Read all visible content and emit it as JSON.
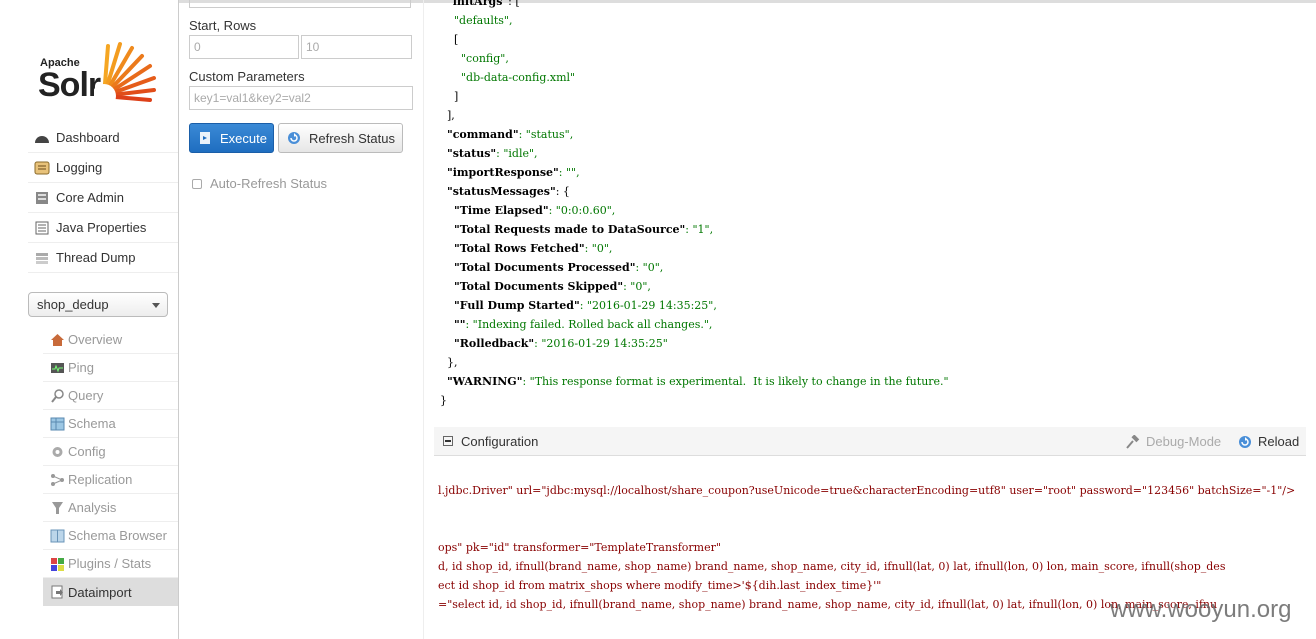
{
  "logo": {
    "apache": "Apache",
    "solr": "Solr"
  },
  "nav": {
    "items": [
      {
        "label": "Dashboard",
        "icon": "dashboard-icon"
      },
      {
        "label": "Logging",
        "icon": "logging-icon"
      },
      {
        "label": "Core Admin",
        "icon": "core-admin-icon"
      },
      {
        "label": "Java Properties",
        "icon": "java-properties-icon"
      },
      {
        "label": "Thread Dump",
        "icon": "thread-dump-icon"
      }
    ]
  },
  "core_selector": {
    "value": "shop_dedup"
  },
  "core_menu": {
    "items": [
      {
        "label": "Overview"
      },
      {
        "label": "Ping"
      },
      {
        "label": "Query"
      },
      {
        "label": "Schema"
      },
      {
        "label": "Config"
      },
      {
        "label": "Replication"
      },
      {
        "label": "Analysis"
      },
      {
        "label": "Schema Browser"
      },
      {
        "label": "Plugins / Stats"
      },
      {
        "label": "Dataimport"
      }
    ],
    "active": "Dataimport"
  },
  "form": {
    "start_rows_label": "Start, Rows",
    "start_value": "0",
    "rows_value": "10",
    "custom_params_label": "Custom Parameters",
    "custom_params_placeholder": "key1=val1&key2=val2",
    "execute_label": "Execute",
    "refresh_label": "Refresh Status",
    "auto_refresh_label": "Auto-Refresh Status"
  },
  "response_lines": [
    {
      "indent": "  ",
      "key": "\"initArgs\"",
      "rest": ": ["
    },
    {
      "indent": "    ",
      "key": "",
      "rest": "\"defaults\","
    },
    {
      "indent": "    ",
      "key": "",
      "rest": "["
    },
    {
      "indent": "      ",
      "key": "",
      "rest": "\"config\","
    },
    {
      "indent": "      ",
      "key": "",
      "rest": "\"db-data-config.xml\""
    },
    {
      "indent": "    ",
      "key": "",
      "rest": "]"
    },
    {
      "indent": "  ",
      "key": "",
      "rest": "],"
    },
    {
      "indent": "  ",
      "key": "\"command\"",
      "rest": ": \"status\","
    },
    {
      "indent": "  ",
      "key": "\"status\"",
      "rest": ": \"idle\","
    },
    {
      "indent": "  ",
      "key": "\"importResponse\"",
      "rest": ": \"\","
    },
    {
      "indent": "  ",
      "key": "\"statusMessages\"",
      "rest": ": {"
    },
    {
      "indent": "    ",
      "key": "\"Time Elapsed\"",
      "rest": ": \"0:0:0.60\","
    },
    {
      "indent": "    ",
      "key": "\"Total Requests made to DataSource\"",
      "rest": ": \"1\","
    },
    {
      "indent": "    ",
      "key": "\"Total Rows Fetched\"",
      "rest": ": \"0\","
    },
    {
      "indent": "    ",
      "key": "\"Total Documents Processed\"",
      "rest": ": \"0\","
    },
    {
      "indent": "    ",
      "key": "\"Total Documents Skipped\"",
      "rest": ": \"0\","
    },
    {
      "indent": "    ",
      "key": "\"Full Dump Started\"",
      "rest": ": \"2016-01-29 14:35:25\","
    },
    {
      "indent": "    ",
      "key": "\"\"",
      "rest": ": \"Indexing failed. Rolled back all changes.\","
    },
    {
      "indent": "    ",
      "key": "\"Rolledback\"",
      "rest": ": \"2016-01-29 14:35:25\""
    },
    {
      "indent": "  ",
      "key": "",
      "rest": "},"
    },
    {
      "indent": "  ",
      "key": "\"WARNING\"",
      "rest": ": \"This response format is experimental.  It is likely to change in the future.\""
    },
    {
      "indent": "",
      "key": "",
      "rest": "}"
    }
  ],
  "configuration": {
    "title": "Configuration",
    "debug_mode_label": "Debug-Mode",
    "reload_label": "Reload",
    "lines": [
      "l.jdbc.Driver\" url=\"jdbc:mysql://localhost/share_coupon?useUnicode=true&characterEncoding=utf8\" user=\"root\" password=\"123456\" batchSize=\"-1\"/>",
      "ops\" pk=\"id\" transformer=\"TemplateTransformer\"",
      "d, id shop_id, ifnull(brand_name, shop_name) brand_name, shop_name, city_id, ifnull(lat, 0) lat, ifnull(lon, 0) lon, main_score, ifnull(shop_des",
      "ect id shop_id from matrix_shops where modify_time>'${dih.last_index_time}'\"",
      "=\"select id, id shop_id, ifnull(brand_name, shop_name) brand_name, shop_name, city_id, ifnull(lat, 0) lat, ifnull(lon, 0) lon, main_score, ifnu"
    ]
  },
  "watermark": "www.wooyun.org"
}
